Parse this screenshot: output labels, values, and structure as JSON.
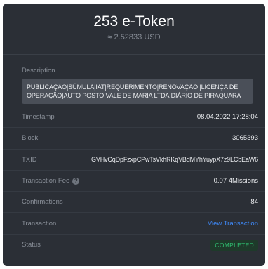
{
  "header": {
    "amount": "253 e-Token",
    "usd": "≈ 2.52833 USD"
  },
  "description": {
    "label": "Description",
    "text": "PUBLICAÇÃO|SÚMULA|IAT|REQUERIMENTO|RENOVAÇÃO |LICENÇA DE OPERAÇÃO|AUTO POSTO VALE DE MARIA LTDA|DIÁRIO DE PIRAQUARA"
  },
  "rows": {
    "timestamp": {
      "label": "Timestamp",
      "value": "08.04.2022 17:28:04"
    },
    "block": {
      "label": "Block",
      "value": "3065393"
    },
    "txid": {
      "label": "TXID",
      "value": "GVHvCqDpFzxpCPwTsVkhRKqVBdMYhYuypX7z9LCbEaW6"
    },
    "fee": {
      "label": "Transaction Fee",
      "value": "0.07 4Missions",
      "help_icon": "help-circle-icon"
    },
    "confirmations": {
      "label": "Confirmations",
      "value": "84"
    },
    "transaction": {
      "label": "Transaction",
      "link": "View Transaction"
    },
    "status": {
      "label": "Status",
      "value": "COMPLETED"
    }
  },
  "colors": {
    "background": "#2b2f36",
    "link": "#3f8cff",
    "status_completed": "#2fbf71"
  }
}
